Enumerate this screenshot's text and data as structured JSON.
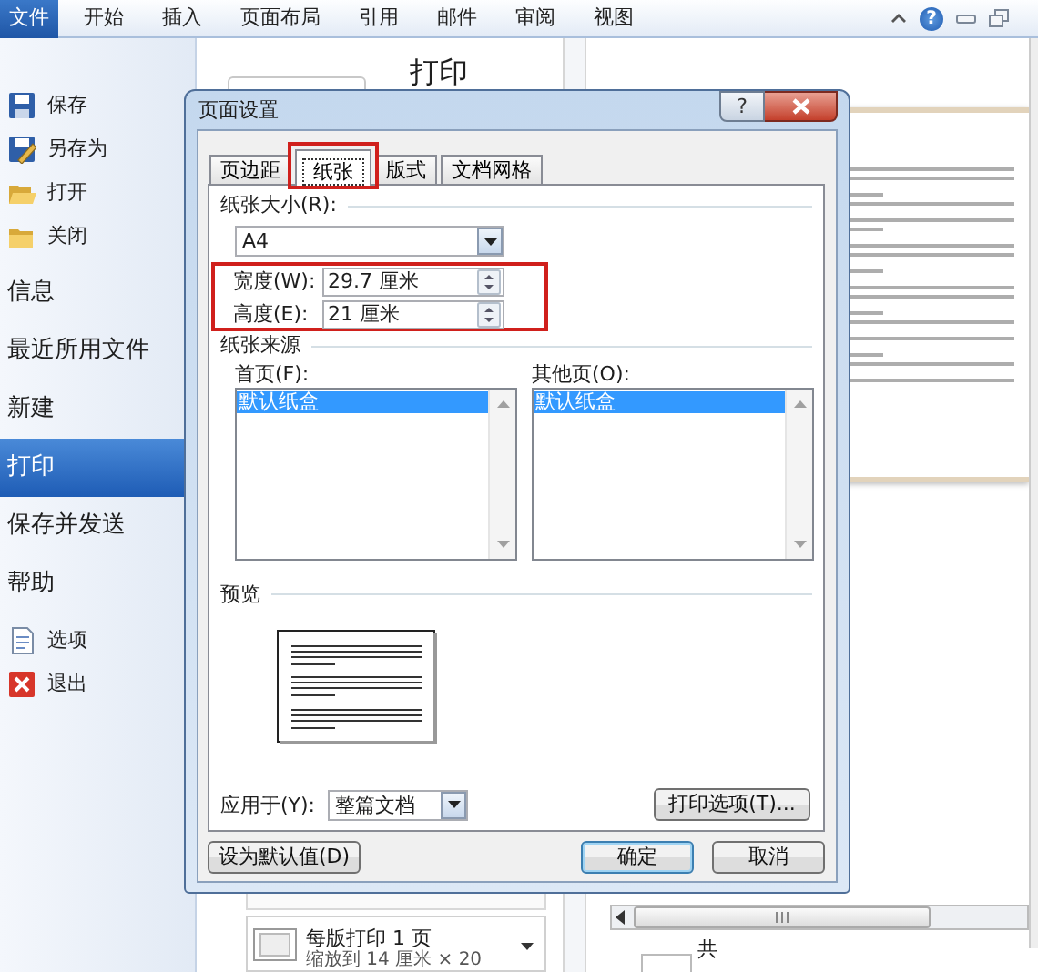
{
  "ribbon": {
    "file_tab": "文件",
    "tabs": [
      "开始",
      "插入",
      "页面布局",
      "引用",
      "邮件",
      "审阅",
      "视图"
    ],
    "help_button": "?"
  },
  "backstage": {
    "items": [
      {
        "kind": "save",
        "label": "保存",
        "selected": false
      },
      {
        "kind": "saveas",
        "label": "另存为",
        "selected": false
      },
      {
        "kind": "open",
        "label": "打开",
        "selected": false
      },
      {
        "kind": "close",
        "label": "关闭",
        "selected": false
      },
      {
        "kind": "page",
        "label": "信息",
        "selected": false
      },
      {
        "kind": "page",
        "label": "最近所用文件",
        "selected": false
      },
      {
        "kind": "page",
        "label": "新建",
        "selected": false
      },
      {
        "kind": "page",
        "label": "打印",
        "selected": true
      },
      {
        "kind": "page",
        "label": "保存并发送",
        "selected": false
      },
      {
        "kind": "page",
        "label": "帮助",
        "selected": false
      },
      {
        "kind": "options",
        "label": "选项",
        "selected": false
      },
      {
        "kind": "exit",
        "label": "退出",
        "selected": false
      }
    ]
  },
  "print_pane": {
    "title": "打印",
    "pages_per_sheet": "每版打印 1 页",
    "scaling": "缩放到 14 厘米 × 20"
  },
  "preview_pane": {
    "page_count_label": "共"
  },
  "dialog": {
    "title": "页面设置",
    "help_button": "?",
    "tabs": [
      {
        "label": "页边距",
        "selected": false,
        "highlighted": false
      },
      {
        "label": "纸张",
        "selected": true,
        "highlighted": true
      },
      {
        "label": "版式",
        "selected": false,
        "highlighted": false
      },
      {
        "label": "文档网格",
        "selected": false,
        "highlighted": false
      }
    ],
    "paper_size": {
      "label": "纸张大小(R):",
      "value": "A4"
    },
    "dimensions": {
      "highlighted": true,
      "fields": [
        {
          "label": "宽度(W):",
          "value": "29.7 厘米"
        },
        {
          "label": "高度(E):",
          "value": "21 厘米"
        }
      ]
    },
    "paper_source": {
      "label": "纸张来源",
      "lists": [
        {
          "label": "首页(F):",
          "items": [
            {
              "text": "默认纸盒",
              "selected": true
            }
          ]
        },
        {
          "label": "其他页(O):",
          "items": [
            {
              "text": "默认纸盒",
              "selected": true
            }
          ]
        }
      ]
    },
    "preview": {
      "label": "预览"
    },
    "apply_to": {
      "label": "应用于(Y):",
      "value": "整篇文档"
    },
    "print_options_button": "打印选项(T)...",
    "buttons": [
      {
        "label": "设为默认值(D)",
        "kind": "left"
      },
      {
        "label": "确定",
        "kind": "default"
      },
      {
        "label": "取消",
        "kind": "normal"
      }
    ]
  }
}
